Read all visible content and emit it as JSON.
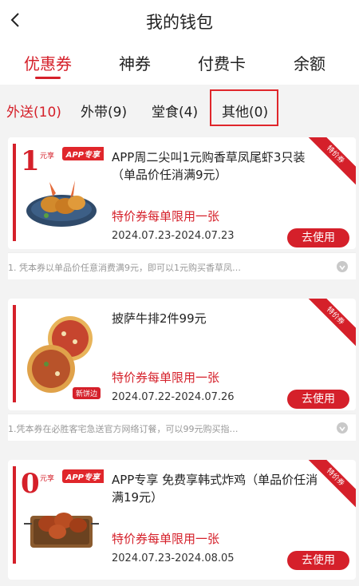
{
  "header": {
    "title": "我的钱包"
  },
  "tabs": [
    {
      "label": "优惠券",
      "active": true
    },
    {
      "label": "神券",
      "active": false
    },
    {
      "label": "付费卡",
      "active": false
    },
    {
      "label": "余额",
      "active": false
    }
  ],
  "subtabs": [
    {
      "label": "外送(10)",
      "active": true
    },
    {
      "label": "外带(9)",
      "active": false
    },
    {
      "label": "堂食(4)",
      "active": false
    },
    {
      "label": "其他(0)",
      "active": false,
      "highlighted": true
    }
  ],
  "colors": {
    "brand_red": "#d5202a",
    "highlight_box": "#e0262b"
  },
  "coupons": [
    {
      "price_big": "1",
      "price_small": "元享",
      "app_badge": "APP专享",
      "title": "APP周二尖叫1元购香草凤尾虾3只装（单品价任消满9元）",
      "limit": "特价券每单限用一张",
      "date": "2024.07.23-2024.07.23",
      "button": "去使用",
      "ribbon": "特价券",
      "note": "1. 凭本券以单品价任意消费满9元，即可以1元购买香草凤…"
    },
    {
      "new_badge": "新饼边",
      "title": "披萨牛排2件99元",
      "limit": "特价券每单限用一张",
      "date": "2024.07.22-2024.07.26",
      "button": "去使用",
      "ribbon": "特价券",
      "note": "1.凭本券在必胜客宅急送官方网络订餐，可以99元购买指…"
    },
    {
      "price_big": "0",
      "price_small": "元享",
      "app_badge": "APP专享",
      "title": "APP专享 免费享韩式炸鸡（单品价任消满19元）",
      "limit": "特价券每单限用一张",
      "date": "2024.07.23-2024.08.05",
      "button": "去使用",
      "ribbon": "特价券"
    }
  ]
}
